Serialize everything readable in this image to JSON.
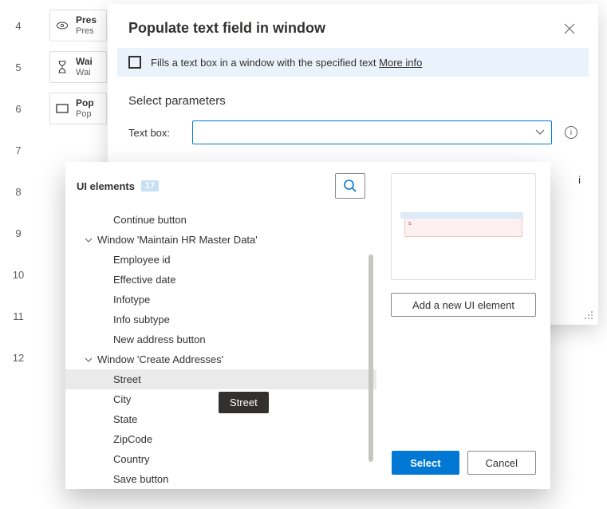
{
  "steps": [
    {
      "num": "4",
      "icon": "cursor",
      "title": "Pres",
      "sub": "Pres"
    },
    {
      "num": "5",
      "icon": "hourglass",
      "title": "Wai",
      "sub": "Wai"
    },
    {
      "num": "6",
      "icon": "rect",
      "title": "Pop",
      "sub": "Pop"
    },
    {
      "num": "7",
      "icon": "",
      "title": "",
      "sub": ""
    },
    {
      "num": "8",
      "icon": "",
      "title": "",
      "sub": ""
    },
    {
      "num": "9",
      "icon": "",
      "title": "",
      "sub": ""
    },
    {
      "num": "10",
      "icon": "",
      "title": "",
      "sub": ""
    },
    {
      "num": "11",
      "icon": "",
      "title": "",
      "sub": ""
    },
    {
      "num": "12",
      "icon": "",
      "title": "",
      "sub": ""
    }
  ],
  "dialog": {
    "title": "Populate text field in window",
    "info_text": "Fills a text box in a window with the specified text ",
    "info_link": "More info",
    "params_heading": "Select parameters",
    "textbox_label": "Text box:"
  },
  "picker": {
    "heading": "UI elements",
    "count": "17",
    "add_label": "Add a new UI element",
    "select": "Select",
    "cancel": "Cancel",
    "tooltip": "Street",
    "preview_val": "s",
    "tree": [
      {
        "type": "node",
        "label": "Continue button"
      },
      {
        "type": "group",
        "label": "Window 'Maintain HR Master Data'"
      },
      {
        "type": "node",
        "label": "Employee id"
      },
      {
        "type": "node",
        "label": "Effective date"
      },
      {
        "type": "node",
        "label": "Infotype"
      },
      {
        "type": "node",
        "label": "Info subtype"
      },
      {
        "type": "node",
        "label": "New address button"
      },
      {
        "type": "group",
        "label": "Window 'Create Addresses'"
      },
      {
        "type": "node",
        "label": "Street",
        "selected": true
      },
      {
        "type": "node",
        "label": "City"
      },
      {
        "type": "node",
        "label": "State"
      },
      {
        "type": "node",
        "label": "ZipCode"
      },
      {
        "type": "node",
        "label": "Country"
      },
      {
        "type": "node",
        "label": "Save button"
      }
    ]
  }
}
